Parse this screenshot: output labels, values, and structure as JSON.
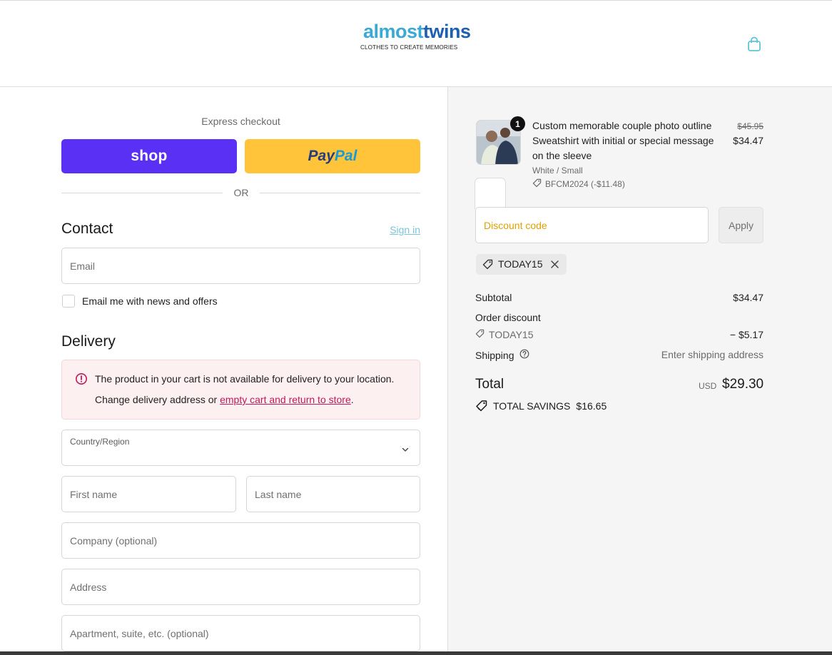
{
  "header": {
    "logo_main_a": "almost",
    "logo_main_b": "twins",
    "logo_tagline": "CLOTHES TO CREATE MEMORIES"
  },
  "express": {
    "title": "Express checkout",
    "shop_label": "shop",
    "paypal_label_a": "Pay",
    "paypal_label_b": "Pal",
    "or_label": "OR"
  },
  "contact": {
    "title": "Contact",
    "signin_label": "Sign in",
    "email_placeholder": "Email",
    "newsletter_label": "Email me with news and offers",
    "newsletter_checked": false
  },
  "delivery": {
    "title": "Delivery",
    "alert_line1": "The product in your cart is not available for delivery to your location.",
    "alert_line2_prefix": "Change delivery address or ",
    "alert_link": "empty cart and return to store",
    "alert_line2_suffix": ".",
    "country_label": "Country/Region",
    "country_value": "",
    "first_name_placeholder": "First name",
    "last_name_placeholder": "Last name",
    "company_placeholder": "Company (optional)",
    "address_placeholder": "Address",
    "apartment_placeholder": "Apartment, suite, etc. (optional)"
  },
  "summary": {
    "item": {
      "quantity": "1",
      "title": "Custom memorable couple photo outline Sweatshirt with initial or special message on the sleeve",
      "variant": "White / Small",
      "discount": "BFCM2024 (-$11.48)",
      "price_original": "$45.95",
      "price": "$34.47"
    },
    "discount_placeholder": "Discount code",
    "apply_label": "Apply",
    "applied_code": "TODAY15",
    "subtotal_label": "Subtotal",
    "subtotal_value": "$34.47",
    "order_discount_label": "Order discount",
    "order_discount_code": "TODAY15",
    "order_discount_value": "− $5.17",
    "shipping_label": "Shipping",
    "shipping_value": "Enter shipping address",
    "total_label": "Total",
    "total_currency": "USD",
    "total_value": "$29.30",
    "savings_label": "TOTAL SAVINGS",
    "savings_value": "$16.65"
  },
  "colors": {
    "shop_brand": "#5a31f4",
    "paypal_bg": "#ffc439",
    "link_accent": "#7cc3dc",
    "alert_link": "#c2185b",
    "summary_bg": "#f5f5f5"
  }
}
